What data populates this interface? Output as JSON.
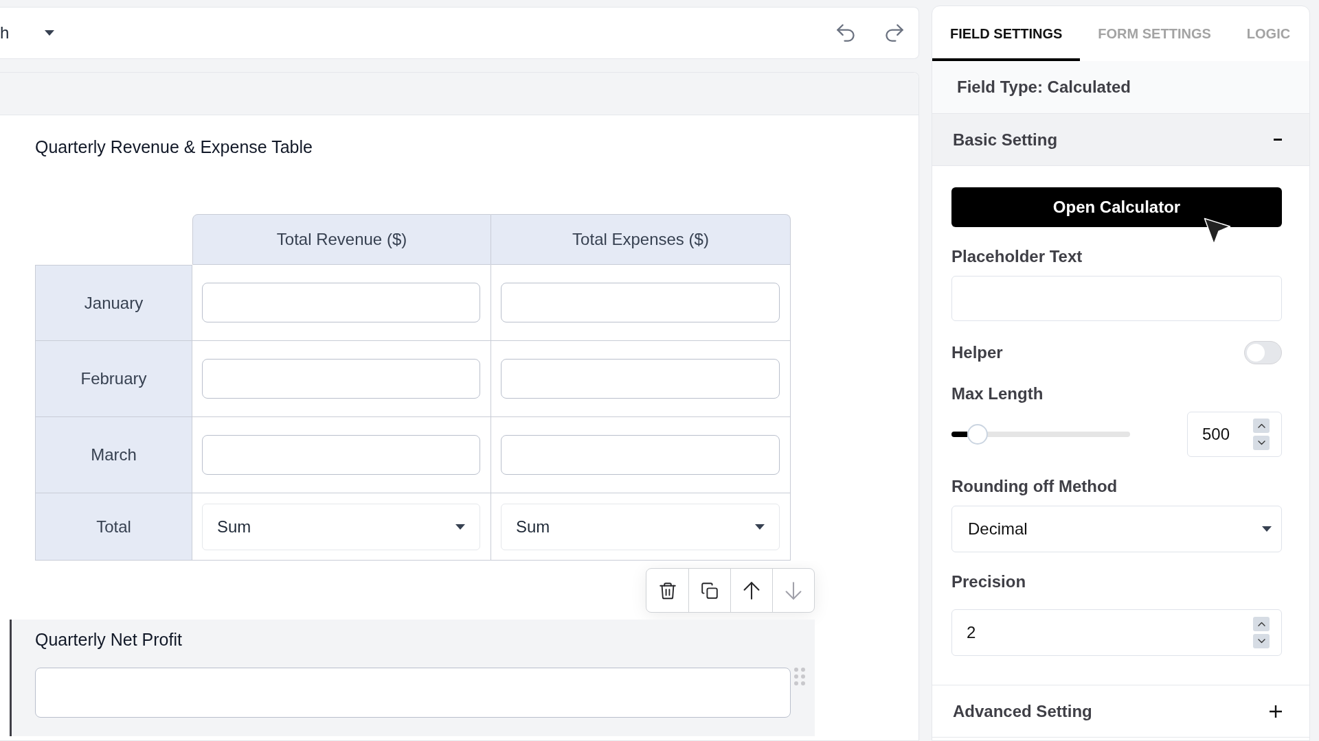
{
  "top_bar": {
    "dropdown": {
      "value": "h"
    }
  },
  "form": {
    "fields": [
      {
        "kind": "table",
        "label": "Quarterly Revenue & Expense Table",
        "selected": false,
        "columns": [
          "Total Revenue ($)",
          "Total Expenses ($)"
        ],
        "rows": [
          {
            "label": "January",
            "kind": "input"
          },
          {
            "label": "February",
            "kind": "input"
          },
          {
            "label": "March",
            "kind": "input"
          },
          {
            "label": "Total",
            "kind": "select",
            "values": [
              "Sum",
              "Sum"
            ]
          }
        ]
      },
      {
        "kind": "calculated",
        "label": "Quarterly Net Profit",
        "selected": true
      }
    ],
    "field_actions": [
      {
        "kind": "delete",
        "disabled": false
      },
      {
        "kind": "duplicate",
        "disabled": false
      },
      {
        "kind": "move_up",
        "disabled": false
      },
      {
        "kind": "move_down",
        "disabled": true
      }
    ]
  },
  "settings_panel": {
    "tabs": [
      {
        "label": "FIELD SETTINGS",
        "selected": true
      },
      {
        "label": "FORM SETTINGS",
        "selected": false
      },
      {
        "label": "LOGIC",
        "selected": false
      }
    ],
    "field_type": "Field Type: Calculated",
    "sections": [
      {
        "title": "Basic Setting",
        "expanded": true,
        "controls": [
          {
            "kind": "button",
            "label": "Open Calculator"
          },
          {
            "kind": "text",
            "label": "Placeholder Text"
          },
          {
            "kind": "toggle",
            "label": "Helper",
            "on": false
          },
          {
            "kind": "slider",
            "label": "Max Length",
            "level": 0.1,
            "value": "500"
          },
          {
            "kind": "select",
            "label": "Rounding off Method",
            "value": "Decimal"
          },
          {
            "kind": "number",
            "label": "Precision",
            "value": "2"
          }
        ]
      },
      {
        "title": "Advanced Setting",
        "expanded": false
      }
    ]
  }
}
